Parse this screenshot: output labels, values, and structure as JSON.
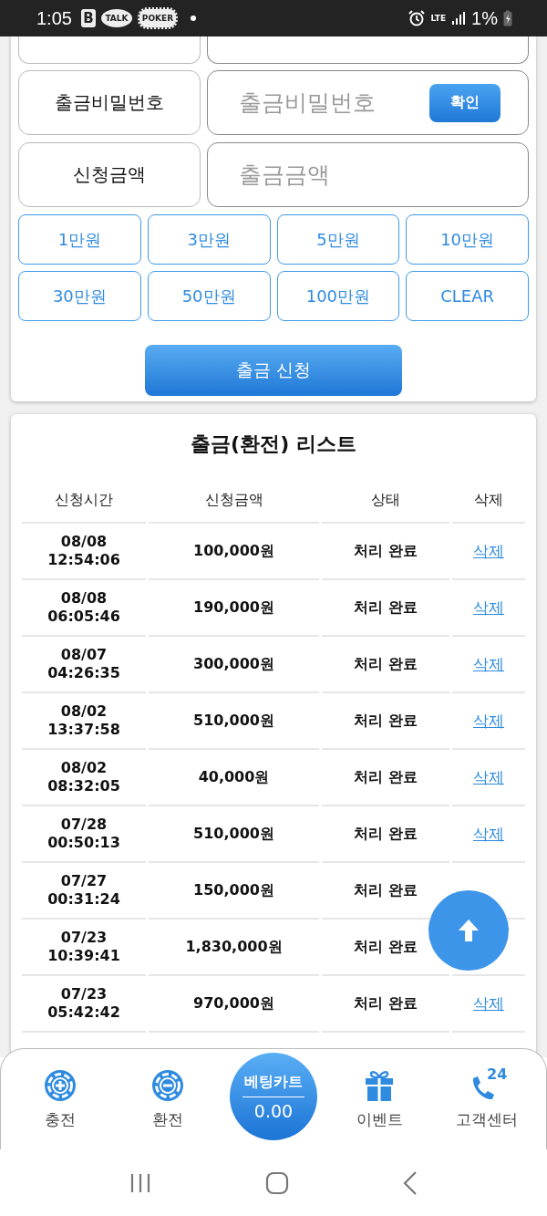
{
  "status_bar": {
    "time": "1:05",
    "notification_icons": [
      {
        "kind": "letter",
        "text": "B"
      },
      {
        "kind": "bubble",
        "text": "TALK"
      },
      {
        "kind": "chip",
        "text": "POKER"
      }
    ],
    "network": "LTE",
    "battery": "1%"
  },
  "form": {
    "rows": [
      {
        "label": "출금비밀번호",
        "placeholder": "출금비밀번호",
        "button": "확인"
      },
      {
        "label": "신청금액",
        "placeholder": "출금금액"
      }
    ],
    "amount_buttons": [
      "1만원",
      "3만원",
      "5만원",
      "10만원",
      "30만원",
      "50만원",
      "100만원",
      "CLEAR"
    ],
    "submit": "출금 신청"
  },
  "list": {
    "title": "출금(환전) 리스트",
    "columns": [
      "신청시간",
      "신청금액",
      "상태",
      "삭제"
    ],
    "rows": [
      {
        "date": "08/08",
        "time": "12:54:06",
        "amount": "100,000원",
        "status": "처리 완료",
        "action": "삭제"
      },
      {
        "date": "08/08",
        "time": "06:05:46",
        "amount": "190,000원",
        "status": "처리 완료",
        "action": "삭제"
      },
      {
        "date": "08/07",
        "time": "04:26:35",
        "amount": "300,000원",
        "status": "처리 완료",
        "action": "삭제"
      },
      {
        "date": "08/02",
        "time": "13:37:58",
        "amount": "510,000원",
        "status": "처리 완료",
        "action": "삭제"
      },
      {
        "date": "08/02",
        "time": "08:32:05",
        "amount": "40,000원",
        "status": "처리 완료",
        "action": "삭제"
      },
      {
        "date": "07/28",
        "time": "00:50:13",
        "amount": "510,000원",
        "status": "처리 완료",
        "action": "삭제"
      },
      {
        "date": "07/27",
        "time": "00:31:24",
        "amount": "150,000원",
        "status": "처리 완료"
      },
      {
        "date": "07/23",
        "time": "10:39:41",
        "amount": "1,830,000원",
        "status": "처리 완료"
      },
      {
        "date": "07/23",
        "time": "05:42:42",
        "amount": "970,000원",
        "status": "처리 완료",
        "action": "삭제"
      }
    ]
  },
  "bottom_nav": [
    {
      "kind": "plus",
      "label": "충전"
    },
    {
      "kind": "minus",
      "label": "환전"
    },
    {
      "kind": "cart",
      "label": "베팅카트",
      "value": "0.00"
    },
    {
      "kind": "gift",
      "label": "이벤트"
    },
    {
      "kind": "phone",
      "label": "고객센터",
      "badge": "24"
    }
  ]
}
